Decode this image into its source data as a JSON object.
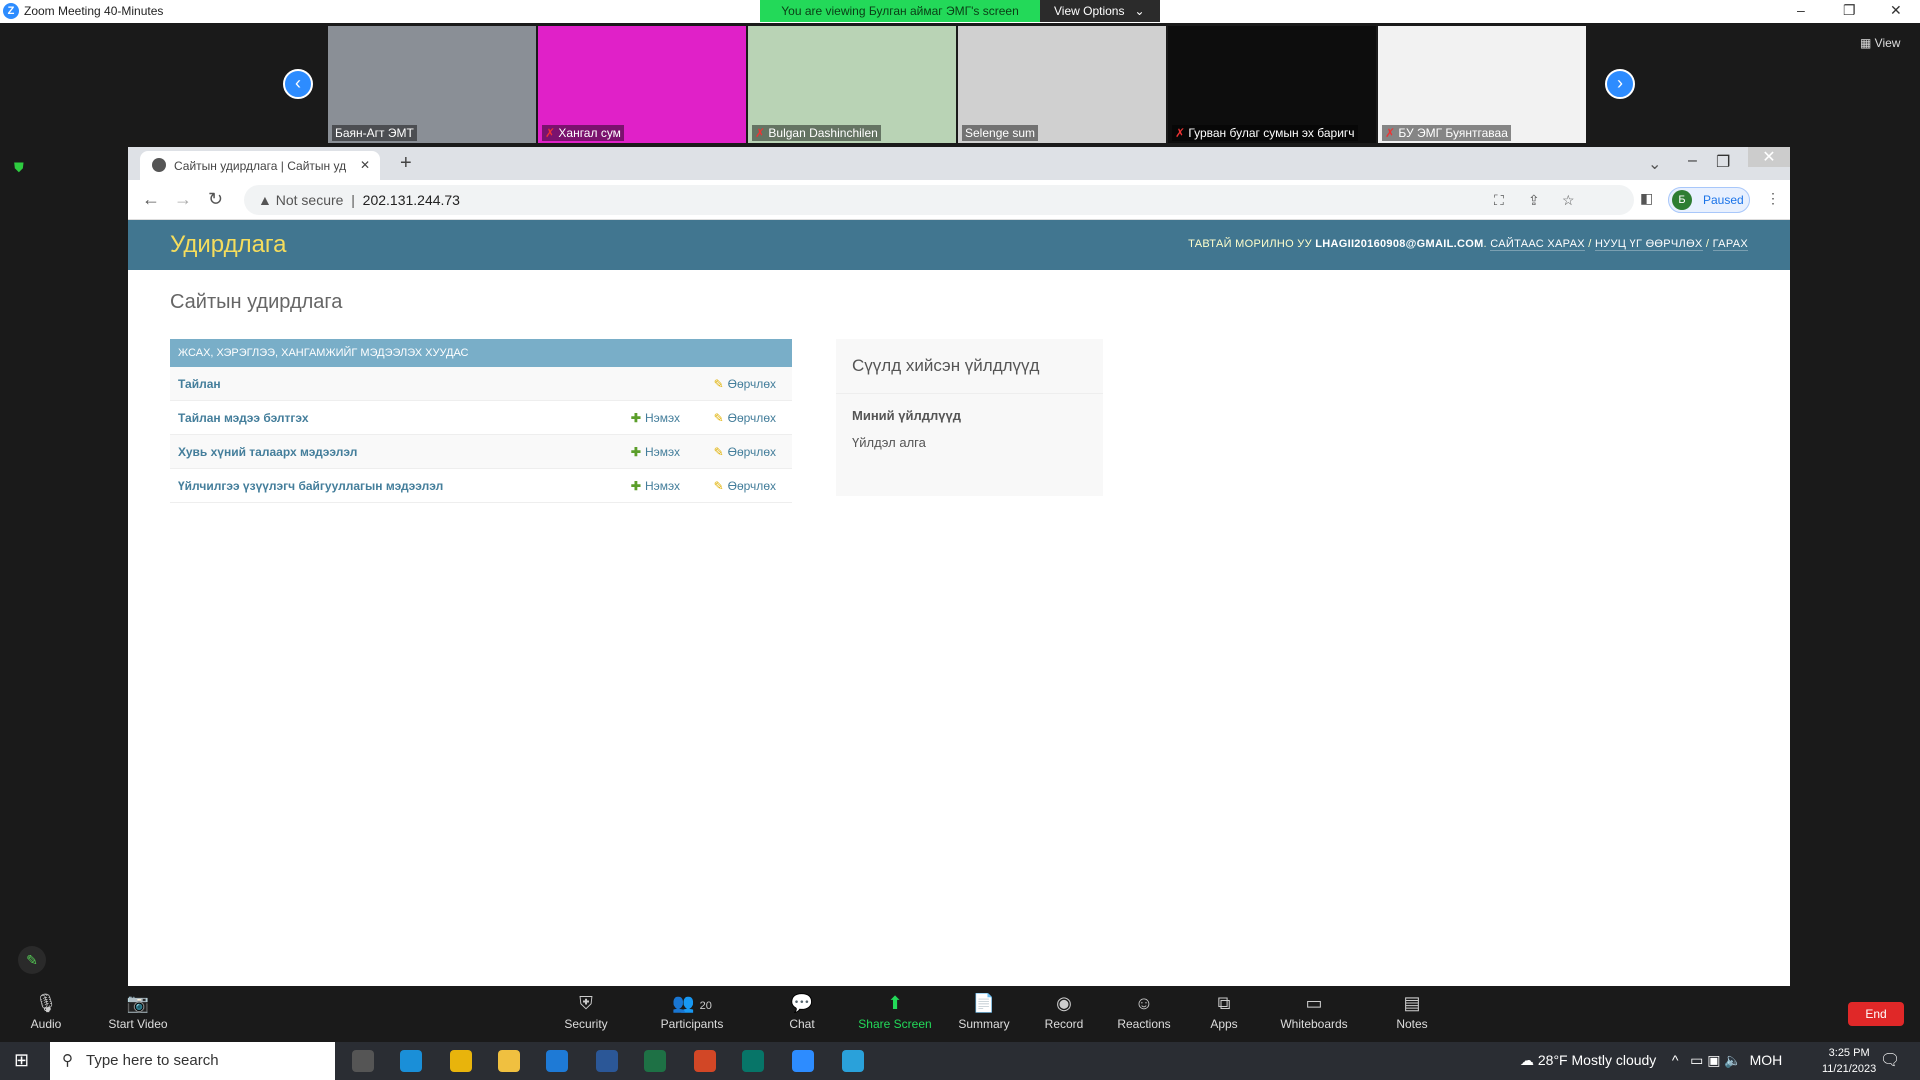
{
  "zoom": {
    "window_title": "Zoom Meeting 40-Minutes",
    "banner": "You are viewing Булган аймаг ЭМГ's screen",
    "view_options": "View Options",
    "view": "View",
    "participants": [
      {
        "name": "Баян-Агт ЭМТ",
        "muted": false,
        "color": "#8a8f96"
      },
      {
        "name": "Хангал сум",
        "muted": true,
        "color": "#e021c8"
      },
      {
        "name": "Bulgan Dashinchilen",
        "muted": true,
        "color": "#b9d3b5"
      },
      {
        "name": "Selenge sum",
        "muted": false,
        "color": "#d0d0d0"
      },
      {
        "name": "Гурван булаг сумын эх баригч",
        "muted": true,
        "color": "#0d0d0d"
      },
      {
        "name": "БУ ЭМГ Буянтгаваа",
        "muted": true,
        "color": "#f2f2f2"
      }
    ],
    "toolbar": {
      "audio": "Audio",
      "video": "Start Video",
      "security": "Security",
      "participants": "Participants",
      "participants_count": "20",
      "chat": "Chat",
      "share": "Share Screen",
      "summary": "Summary",
      "record": "Record",
      "reactions": "Reactions",
      "apps": "Apps",
      "whiteboards": "Whiteboards",
      "notes": "Notes",
      "end": "End"
    }
  },
  "browser": {
    "tab_title": "Сайтын удирдлага | Сайтын уд",
    "not_secure": "Not secure",
    "url": "202.131.244.73",
    "profile_initial": "Б",
    "profile_status": "Paused"
  },
  "page": {
    "brand": "Удирдлага",
    "welcome": "ТАВТАЙ МОРИЛНО УУ",
    "user": "LHAGII20160908@GMAIL.COM",
    "view_site": "САЙТААС ХАРАХ",
    "change_password": "НУУЦ ҮГ ӨӨРЧЛӨХ",
    "logout": "ГАРАХ",
    "title": "Сайтын удирдлага",
    "module": {
      "caption": "ЖСАХ, ХЭРЭГЛЭЭ, ХАНГАМЖИЙГ МЭДЭЭЛЭХ ХУУДАС",
      "add_label": "Нэмэх",
      "change_label": "Өөрчлөх",
      "rows": [
        {
          "name": "Тайлан",
          "has_add": false
        },
        {
          "name": "Тайлан мэдээ бэлтгэх",
          "has_add": true
        },
        {
          "name": "Хувь хүний талаарх мэдээлэл",
          "has_add": true
        },
        {
          "name": "Үйлчилгээ үзүүлэгч байгууллагын мэдээлэл",
          "has_add": true
        }
      ]
    },
    "recent": {
      "title": "Сүүлд хийсэн үйлдлүүд",
      "my_actions": "Миний үйлдлүүд",
      "none": "Үйлдэл алга"
    }
  },
  "taskbar": {
    "search_placeholder": "Type here to search",
    "weather": "28°F  Mostly cloudy",
    "lang": "МОН",
    "time": "3:25 PM",
    "date": "11/21/2023"
  }
}
